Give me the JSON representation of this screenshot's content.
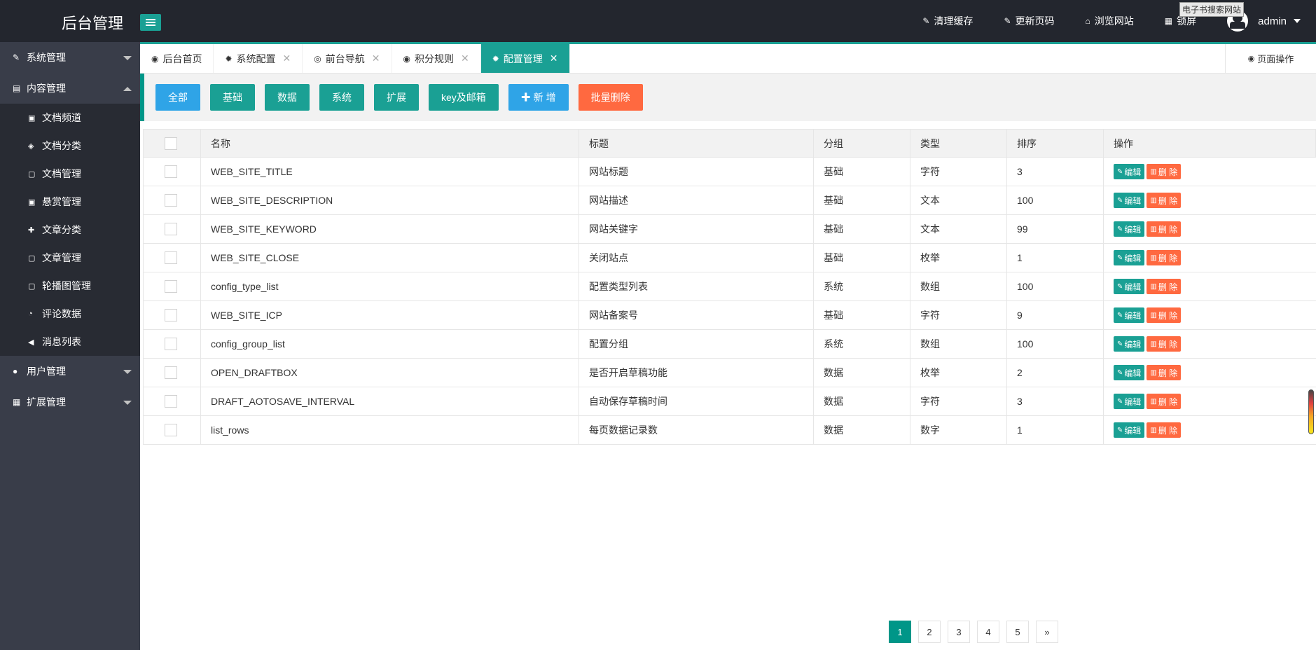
{
  "app": {
    "title": "后台管理",
    "tooltip": "电子书搜索网站"
  },
  "header": {
    "links": [
      {
        "icon": "eraser-icon",
        "glyph": "✎",
        "label": "清理缓存"
      },
      {
        "icon": "refresh-icon",
        "glyph": "✎",
        "label": "更新页码"
      },
      {
        "icon": "home-icon",
        "glyph": "⌂",
        "label": "浏览网站"
      },
      {
        "icon": "lock-icon",
        "glyph": "▦",
        "label": "锁屏"
      }
    ],
    "user": "admin"
  },
  "sidebar": {
    "groups": [
      {
        "label": "系统管理",
        "icon": "wrench-icon",
        "glyph": "✎",
        "expanded": false,
        "items": []
      },
      {
        "label": "内容管理",
        "icon": "content-icon",
        "glyph": "▤",
        "expanded": true,
        "items": [
          {
            "label": "文档频道",
            "icon": "channel-icon",
            "glyph": "▣"
          },
          {
            "label": "文档分类",
            "icon": "category-icon",
            "glyph": "◈"
          },
          {
            "label": "文档管理",
            "icon": "doc-icon",
            "glyph": "▢"
          },
          {
            "label": "悬赏管理",
            "icon": "reward-icon",
            "glyph": "▣"
          },
          {
            "label": "文章分类",
            "icon": "puzzle-icon",
            "glyph": "✚"
          },
          {
            "label": "文章管理",
            "icon": "article-icon",
            "glyph": "▢"
          },
          {
            "label": "轮播图管理",
            "icon": "banner-icon",
            "glyph": "▢"
          },
          {
            "label": "评论数据",
            "icon": "comment-icon",
            "glyph": "◔"
          },
          {
            "label": "消息列表",
            "icon": "speaker-icon",
            "glyph": "◀"
          }
        ]
      },
      {
        "label": "用户管理",
        "icon": "user-icon",
        "glyph": "●",
        "expanded": false,
        "items": []
      },
      {
        "label": "扩展管理",
        "icon": "extend-icon",
        "glyph": "▦",
        "expanded": false,
        "items": []
      }
    ]
  },
  "tabs": {
    "items": [
      {
        "label": "后台首页",
        "icon": "dashboard-icon",
        "glyph": "◉",
        "closable": false,
        "active": false
      },
      {
        "label": "系统配置",
        "icon": "gear-icon",
        "glyph": "✹",
        "closable": true,
        "active": false
      },
      {
        "label": "前台导航",
        "icon": "lifebuoy-icon",
        "glyph": "◎",
        "closable": true,
        "active": false
      },
      {
        "label": "积分规则",
        "icon": "radio-icon",
        "glyph": "◉",
        "closable": true,
        "active": false
      },
      {
        "label": "配置管理",
        "icon": "cogs-icon",
        "glyph": "✹",
        "closable": true,
        "active": true
      }
    ],
    "page_ops": "页面操作"
  },
  "toolbar": {
    "buttons": [
      {
        "label": "全部",
        "style": "blue"
      },
      {
        "label": "基础",
        "style": "green"
      },
      {
        "label": "数据",
        "style": "green"
      },
      {
        "label": "系统",
        "style": "green"
      },
      {
        "label": "扩展",
        "style": "green"
      },
      {
        "label": "key及邮箱",
        "style": "green"
      },
      {
        "label": "✚ 新 增",
        "style": "blue"
      },
      {
        "label": "批量删除",
        "style": "orange"
      }
    ]
  },
  "table": {
    "columns": [
      "名称",
      "标题",
      "分组",
      "类型",
      "排序",
      "操作"
    ],
    "edit_label": "编辑",
    "delete_label": "删 除",
    "rows": [
      {
        "name": "WEB_SITE_TITLE",
        "title": "网站标题",
        "group": "基础",
        "type": "字符",
        "sort": "3"
      },
      {
        "name": "WEB_SITE_DESCRIPTION",
        "title": "网站描述",
        "group": "基础",
        "type": "文本",
        "sort": "100"
      },
      {
        "name": "WEB_SITE_KEYWORD",
        "title": "网站关键字",
        "group": "基础",
        "type": "文本",
        "sort": "99"
      },
      {
        "name": "WEB_SITE_CLOSE",
        "title": "关闭站点",
        "group": "基础",
        "type": "枚举",
        "sort": "1"
      },
      {
        "name": "config_type_list",
        "title": "配置类型列表",
        "group": "系统",
        "type": "数组",
        "sort": "100"
      },
      {
        "name": "WEB_SITE_ICP",
        "title": "网站备案号",
        "group": "基础",
        "type": "字符",
        "sort": "9"
      },
      {
        "name": "config_group_list",
        "title": "配置分组",
        "group": "系统",
        "type": "数组",
        "sort": "100"
      },
      {
        "name": "OPEN_DRAFTBOX",
        "title": "是否开启草稿功能",
        "group": "数据",
        "type": "枚举",
        "sort": "2"
      },
      {
        "name": "DRAFT_AOTOSAVE_INTERVAL",
        "title": "自动保存草稿时间",
        "group": "数据",
        "type": "字符",
        "sort": "3"
      },
      {
        "name": "list_rows",
        "title": "每页数据记录数",
        "group": "数据",
        "type": "数字",
        "sort": "1"
      }
    ]
  },
  "pagination": {
    "pages": [
      "1",
      "2",
      "3",
      "4",
      "5"
    ],
    "current": "1",
    "next": "»"
  },
  "colors": {
    "header_bg": "#23262e",
    "sidebar_bg": "#393d49",
    "accent": "#1aa094",
    "blue": "#2fa4e7",
    "orange": "#ff6940"
  }
}
